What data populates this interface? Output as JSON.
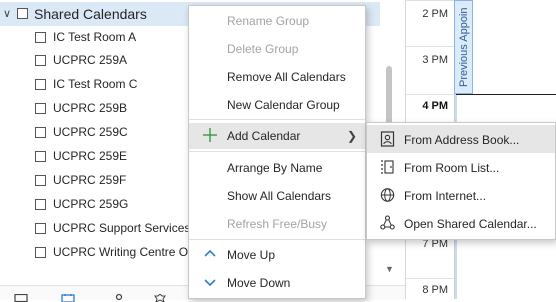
{
  "folder_pane": {
    "group": {
      "label": "Shared Calendars",
      "expanded": true
    },
    "calendars": [
      {
        "label": "IC Test Room A"
      },
      {
        "label": "UCPRC 259A"
      },
      {
        "label": "IC Test Room C"
      },
      {
        "label": "UCPRC 259B"
      },
      {
        "label": "UCPRC 259C"
      },
      {
        "label": "UCPRC 259E"
      },
      {
        "label": "UCPRC 259F"
      },
      {
        "label": "UCPRC 259G"
      },
      {
        "label": "UCPRC Support Services C"
      },
      {
        "label": "UCPRC Writing Centre Or"
      }
    ],
    "nav_icons": [
      "mail-icon",
      "calendar-icon",
      "people-icon",
      "tasks-icon"
    ]
  },
  "calendar_pane": {
    "hours": [
      {
        "label": "2 PM",
        "bold": false
      },
      {
        "label": "3 PM",
        "bold": false
      },
      {
        "label": "4 PM",
        "bold": true
      },
      {
        "label": "7 PM",
        "bold": false
      },
      {
        "label": "8 PM",
        "bold": false
      }
    ],
    "previous_appointment": "Previous Appoin"
  },
  "context_menu": {
    "items": [
      {
        "label": "Rename Group",
        "disabled": true
      },
      {
        "label": "Delete Group",
        "disabled": true
      },
      {
        "label": "Remove All Calendars",
        "disabled": false
      },
      {
        "label": "New Calendar Group",
        "disabled": false
      },
      {
        "label": "Add Calendar",
        "disabled": false,
        "icon": "plus-icon",
        "submenu": true,
        "highlighted": true
      },
      {
        "label": "Arrange By Name",
        "disabled": false
      },
      {
        "label": "Show All Calendars",
        "disabled": false
      },
      {
        "label": "Refresh Free/Busy",
        "disabled": true
      },
      {
        "label": "Move Up",
        "disabled": false,
        "icon": "chevron-up-icon"
      },
      {
        "label": "Move Down",
        "disabled": false,
        "icon": "chevron-down-icon"
      }
    ]
  },
  "add_calendar_submenu": {
    "items": [
      {
        "label": "From Address Book...",
        "icon": "address-book-icon",
        "highlighted": true
      },
      {
        "label": "From Room List...",
        "icon": "room-list-icon"
      },
      {
        "label": "From Internet...",
        "icon": "globe-icon"
      },
      {
        "label": "Open Shared Calendar...",
        "icon": "shared-calendar-icon"
      }
    ]
  },
  "colors": {
    "group_highlight": "#dbe8f6",
    "menu_highlight": "#e6e6e6",
    "disabled_text": "#a3a3a3",
    "accent_blue": "#2b7cd3",
    "plus_green": "#2f9e44"
  }
}
